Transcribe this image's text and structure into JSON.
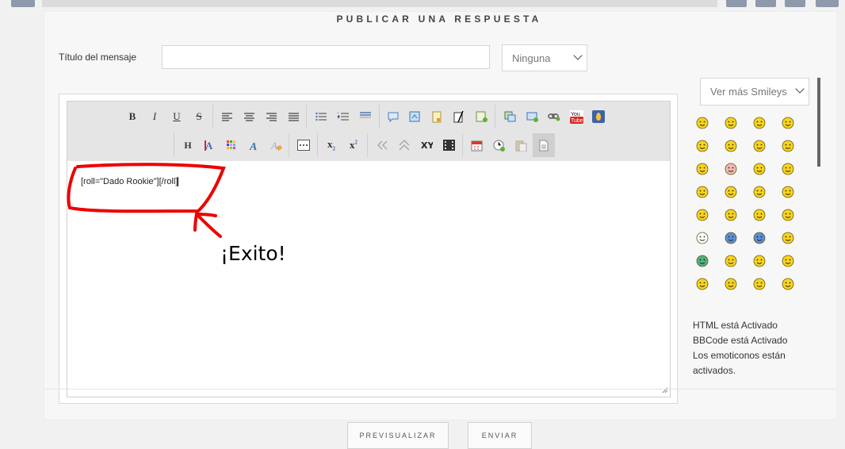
{
  "heading": "PUBLICAR UNA RESPUESTA",
  "form": {
    "title_label": "Título del mensaje",
    "title_value": "",
    "icon_select": "Ninguna",
    "smileys_select": "Ver más Smileys"
  },
  "editor": {
    "content": "[roll=\"Dado Rookie\"][/roll]",
    "annotation": "¡Exito!"
  },
  "status": {
    "html": "HTML está Activado",
    "bbcode": "BBCode está Activado",
    "emoticons_line1": "Los emoticonos están",
    "emoticons_line2": "activados."
  },
  "buttons": {
    "preview": "PREVISUALIZAR",
    "send": "ENVIAR"
  },
  "toolbar_row1": [
    "bold",
    "italic",
    "underline",
    "strike",
    "align-left",
    "align-center",
    "align-right",
    "justify",
    "bullet-list",
    "numbered-list",
    "horizontal-rule",
    "quote",
    "code",
    "spoiler",
    "hide",
    "table",
    "image",
    "media",
    "link",
    "youtube",
    "upload"
  ],
  "toolbar_row2": [
    "heading",
    "text-color",
    "color-grid",
    "font",
    "remove-format",
    "more",
    "subscript",
    "superscript",
    "undo",
    "scroll",
    "flip",
    "video",
    "date",
    "time",
    "paste",
    "source"
  ],
  "smileys": [
    "grin",
    "smile",
    "wink",
    "cheese",
    "cool",
    "sunglasses",
    "lol",
    "laugh",
    "tongue",
    "blush",
    "sad",
    "evil",
    "twisted",
    "eek",
    "neutral",
    "exclaim",
    "question",
    "idea",
    "arrow",
    "confused",
    "alien",
    "star",
    "ninja",
    "love",
    "sick",
    "confused2",
    "neutral2",
    "silly",
    "biggrin",
    "happy",
    "shock",
    "worried"
  ]
}
